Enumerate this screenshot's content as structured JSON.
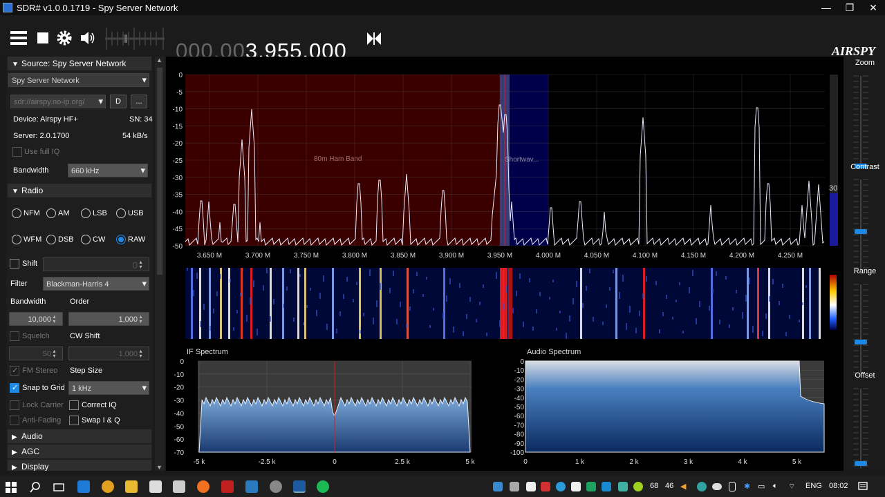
{
  "window": {
    "title": "SDR# v1.0.0.1719 - Spy Server Network",
    "controls": [
      "—",
      "❐",
      "✕"
    ]
  },
  "toolbar": {
    "freq_dim": "000.00",
    "freq_main": "3.955.000",
    "logo": "AIRSPY"
  },
  "source": {
    "header": "Source: Spy Server Network",
    "selected": "Spy Server Network",
    "url": "sdr://airspy.no-ip.org/",
    "d_btn": "D",
    "more_btn": "...",
    "device": "Device: Airspy HF+",
    "sn": "SN: 34",
    "server": "Server: 2.0.1700",
    "rate": "54 kB/s",
    "use_full_iq": "Use full IQ",
    "bandwidth_label": "Bandwidth",
    "bandwidth_value": "660 kHz"
  },
  "radio": {
    "header": "Radio",
    "modes": [
      "NFM",
      "AM",
      "LSB",
      "USB",
      "WFM",
      "DSB",
      "CW",
      "RAW"
    ],
    "selected_mode": "RAW",
    "shift_label": "Shift",
    "shift_value": "0",
    "filter_label": "Filter",
    "filter_value": "Blackman-Harris 4",
    "bandwidth_label": "Bandwidth",
    "order_label": "Order",
    "bandwidth_value": "10,000",
    "order_value": "1,000",
    "squelch": "Squelch",
    "cw_shift": "CW Shift",
    "squelch_value": "50",
    "cw_shift_value": "1,000",
    "fm_stereo": "FM Stereo",
    "step_size": "Step Size",
    "snap_to_grid": "Snap to Grid",
    "step_value": "1 kHz",
    "lock_carrier": "Lock Carrier",
    "correct_iq": "Correct IQ",
    "anti_fading": "Anti-Fading",
    "swap_iq": "Swap I & Q"
  },
  "collapsed_sections": [
    "Audio",
    "AGC",
    "Display"
  ],
  "sidebar": {
    "zoom": "Zoom",
    "contrast": "Contrast",
    "range": "Range",
    "offset": "Offset",
    "range_value": "30"
  },
  "spectrum": {
    "y_ticks": [
      "0",
      "-5",
      "-10",
      "-15",
      "-20",
      "-25",
      "-30",
      "-35",
      "-40",
      "-45",
      "-50"
    ],
    "x_ticks": [
      "3.650 M",
      "3.700 M",
      "3.750 M",
      "3.800 M",
      "3.850 M",
      "3.900 M",
      "3.950 M",
      "4.000 M",
      "4.050 M",
      "4.100 M",
      "4.150 M",
      "4.200 M",
      "4.250 M"
    ],
    "band1": "80m Ham Band",
    "band2": "Shortwav..."
  },
  "if_spectrum": {
    "title": "IF Spectrum",
    "y_ticks": [
      "0",
      "-10",
      "-20",
      "-30",
      "-40",
      "-50",
      "-60",
      "-70"
    ],
    "x_ticks": [
      "-5 k",
      "-2.5 k",
      "0",
      "2.5 k",
      "5 k"
    ]
  },
  "audio_spectrum": {
    "title": "Audio Spectrum",
    "y_ticks": [
      "0",
      "-10",
      "-20",
      "-30",
      "-40",
      "-50",
      "-60",
      "-70",
      "-80",
      "-90",
      "-100"
    ],
    "x_ticks": [
      "0",
      "1 k",
      "2 k",
      "3 k",
      "4 k",
      "5 k"
    ]
  },
  "taskbar": {
    "tray_num1": "68",
    "tray_num2": "46",
    "lang": "ENG",
    "time": "08:02"
  },
  "colors": {
    "accent": "#1e88e5",
    "ham_band": "#3a0000",
    "sw_band": "#00004a",
    "trace": "#e0e0ff"
  }
}
